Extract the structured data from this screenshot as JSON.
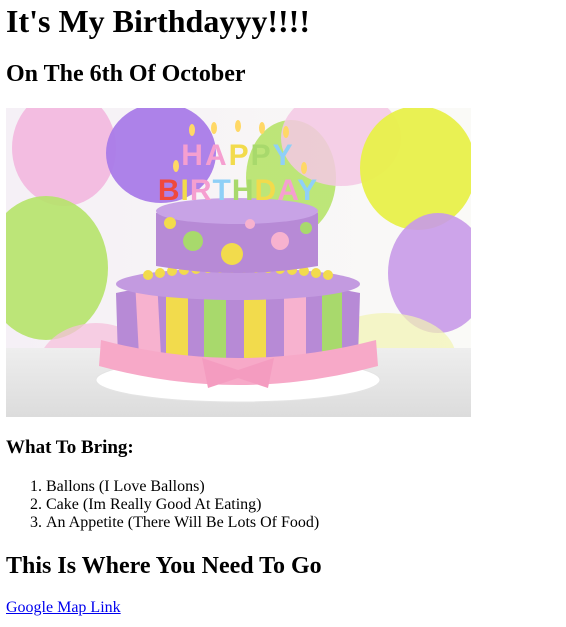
{
  "page": {
    "title": "It's My Birthdayyy!!!!",
    "subtitle": "On The 6th Of October"
  },
  "hero_image": {
    "cake_text": "HAPPY BIRTHDAY",
    "colors": {
      "balloon_purple": "#a97be8",
      "balloon_yellow": "#e8f04a",
      "balloon_green": "#b6e36a",
      "balloon_pink": "#f3b7df",
      "cake_purple": "#b78ad6",
      "cake_pink": "#f7b2cf",
      "cake_yellow": "#f2db4c",
      "cake_green": "#a8d96c"
    }
  },
  "bring": {
    "heading": "What To Bring:",
    "items": [
      "Ballons (I Love Ballons)",
      "Cake (Im Really Good At Eating)",
      "An Appetite (There Will Be Lots Of Food)"
    ]
  },
  "directions": {
    "heading": "This Is Where You Need To Go",
    "link_label": "Google Map Link"
  }
}
